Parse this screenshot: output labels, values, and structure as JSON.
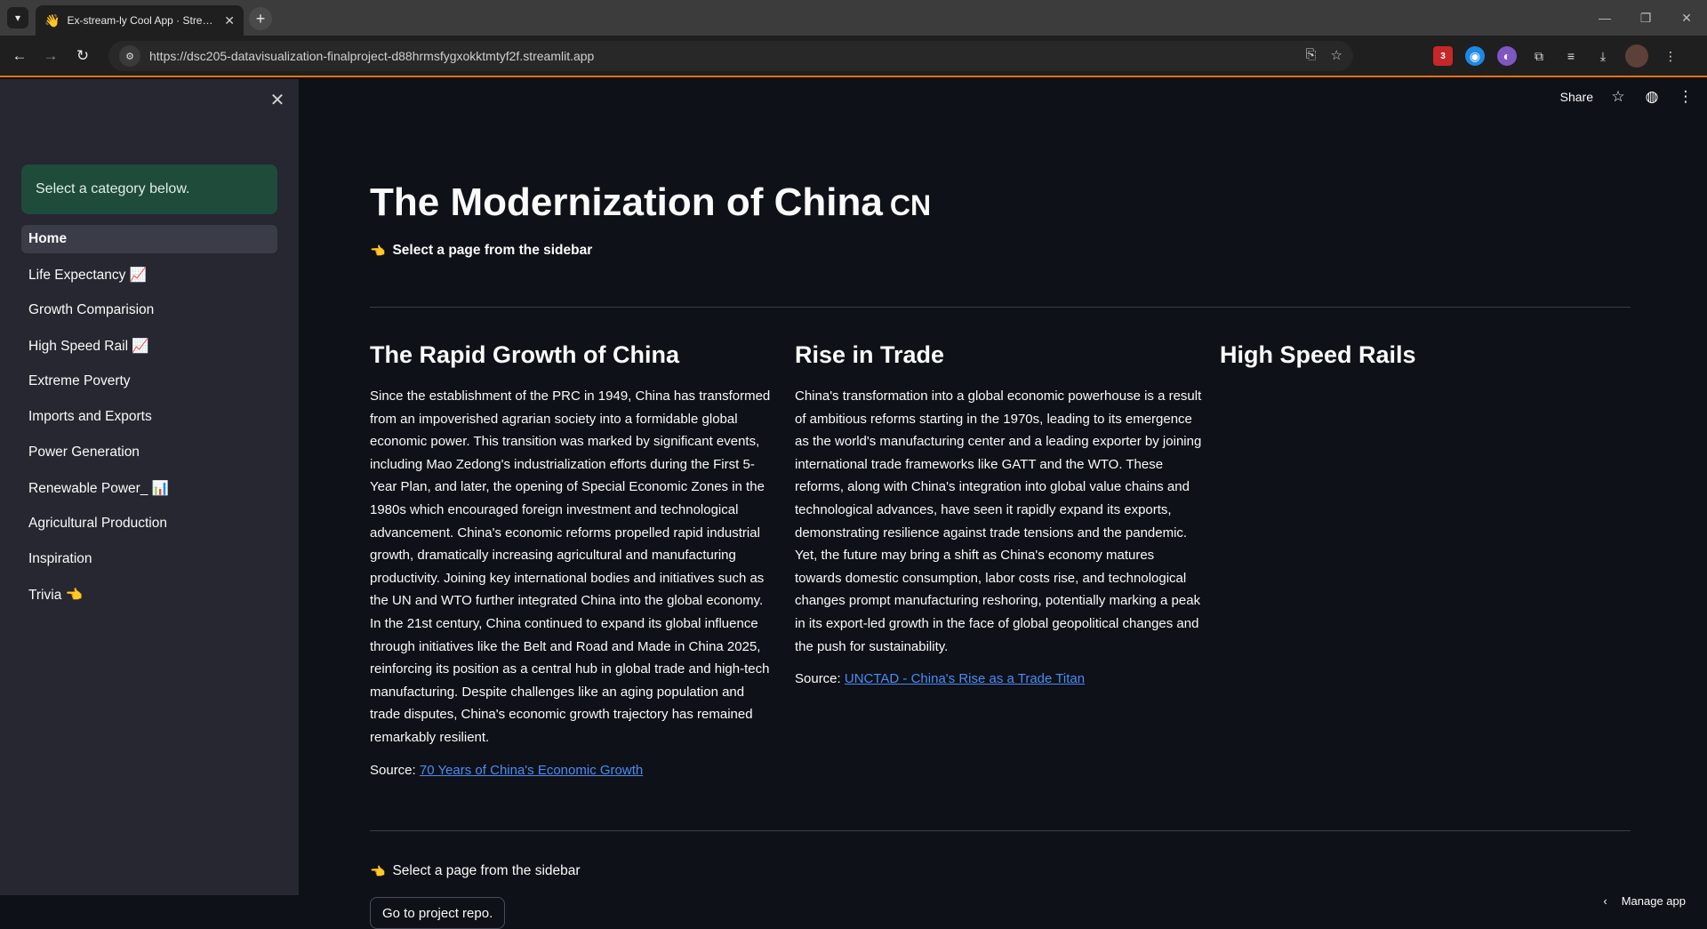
{
  "browser": {
    "tab_title": "Ex-stream-ly Cool App · Streamlit",
    "url": "https://dsc205-datavisualization-finalproject-d88hrmsfygxokktmtyf2f.streamlit.app",
    "ext_badge": "3"
  },
  "sidebar": {
    "info": "Select a category below.",
    "items": [
      {
        "label": "Home"
      },
      {
        "label": "Life Expectancy 📈"
      },
      {
        "label": "Growth Comparision"
      },
      {
        "label": "High Speed Rail 📈"
      },
      {
        "label": "Extreme Poverty"
      },
      {
        "label": "Imports and Exports"
      },
      {
        "label": "Power Generation"
      },
      {
        "label": "Renewable Power_ 📊"
      },
      {
        "label": "Agricultural Production"
      },
      {
        "label": "Inspiration"
      },
      {
        "label": "Trivia 👈"
      }
    ]
  },
  "header": {
    "share_label": "Share"
  },
  "main": {
    "title": "The Modernization of China",
    "title_flag": "CN",
    "select_prompt": "Select a page from the sidebar",
    "select_prompt_bottom": "Select a page from the sidebar",
    "columns": [
      {
        "heading": "The Rapid Growth of China",
        "body": "Since the establishment of the PRC in 1949, China has transformed from an impoverished agrarian society into a formidable global economic power. This transition was marked by significant events, including Mao Zedong's industrialization efforts during the First 5-Year Plan, and later, the opening of Special Economic Zones in the 1980s which encouraged foreign investment and technological advancement. China's economic reforms propelled rapid industrial growth, dramatically increasing agricultural and manufacturing productivity. Joining key international bodies and initiatives such as the UN and WTO further integrated China into the global economy. In the 21st century, China continued to expand its global influence through initiatives like the Belt and Road and Made in China 2025, reinforcing its position as a central hub in global trade and high-tech manufacturing. Despite challenges like an aging population and trade disputes, China's economic growth trajectory has remained remarkably resilient.",
        "source_prefix": "Source:",
        "source_link": "70 Years of China's Economic Growth"
      },
      {
        "heading": "Rise in Trade",
        "body": "China's transformation into a global economic powerhouse is a result of ambitious reforms starting in the 1970s, leading to its emergence as the world's manufacturing center and a leading exporter by joining international trade frameworks like GATT and the WTO. These reforms, along with China's integration into global value chains and technological advances, have seen it rapidly expand its exports, demonstrating resilience against trade tensions and the pandemic. Yet, the future may bring a shift as China's economy matures towards domestic consumption, labor costs rise, and technological changes prompt manufacturing reshoring, potentially marking a peak in its export-led growth in the face of global geopolitical changes and the push for sustainability.",
        "source_prefix": "Source:",
        "source_link": "UNCTAD - China's Rise as a Trade Titan"
      },
      {
        "heading": "High Speed Rails"
      }
    ],
    "repo_button": "Go to project repo.",
    "manage_app": "Manage app"
  },
  "colors": {
    "background": "#0e1117",
    "sidebar": "#262730",
    "info_box": "#1f4b3a",
    "link": "#4b8cf5",
    "accent_line": "#e8710a"
  }
}
